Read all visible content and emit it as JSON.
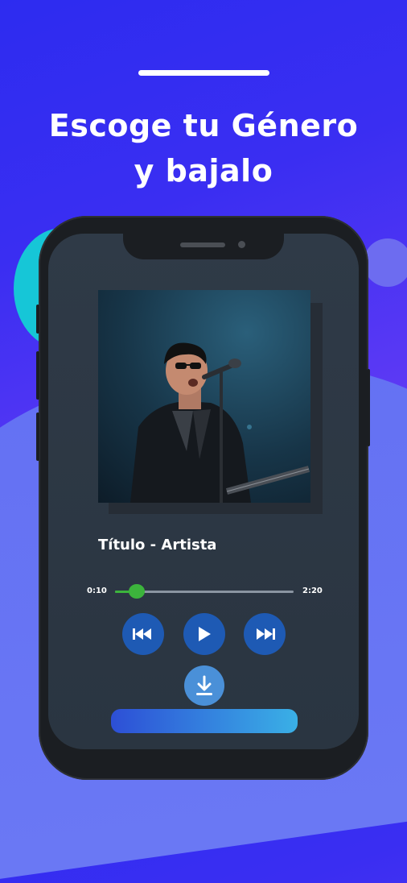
{
  "headline": {
    "line1": "Escoge tu Género",
    "line2": "y bajalo"
  },
  "player": {
    "track_title": "Título - Artista",
    "time_elapsed": "0:10",
    "time_total": "2:20",
    "progress": 0.12
  },
  "icons": {
    "previous": "rewind-icon",
    "play": "play-icon",
    "next": "fast-forward-icon",
    "download": "download-icon"
  },
  "colors": {
    "background": "#3a2ef2",
    "accent_teal": "#16c6d7",
    "progress": "#3cb43c",
    "control_button": "#1e5ab4",
    "download_button": "#4a90d8"
  }
}
